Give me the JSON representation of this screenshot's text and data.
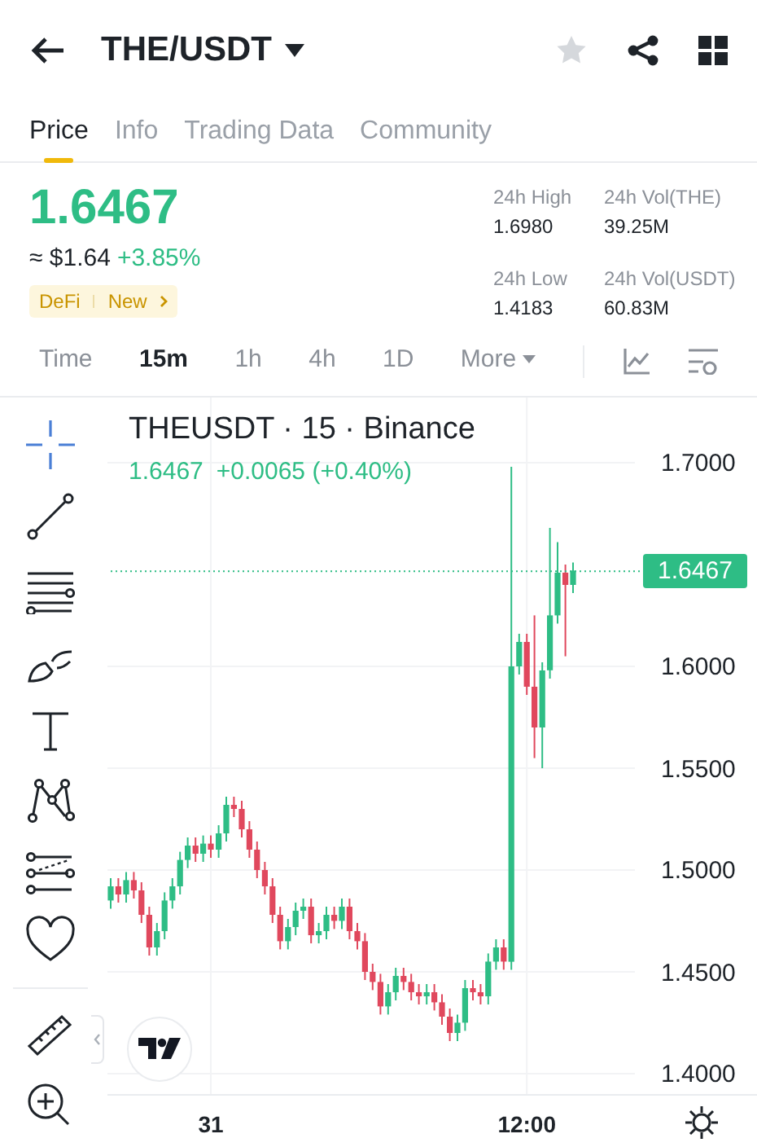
{
  "header": {
    "title": "THE/USDT",
    "favorite": false
  },
  "tabs": [
    {
      "label": "Price",
      "selected": true
    },
    {
      "label": "Info",
      "selected": false
    },
    {
      "label": "Trading Data",
      "selected": false
    },
    {
      "label": "Community",
      "selected": false
    }
  ],
  "price": {
    "last": "1.6467",
    "usd": "≈ $1.64",
    "change": "+3.85%",
    "tags": [
      "DeFi",
      "New"
    ]
  },
  "stats": [
    {
      "label": "24h High",
      "value": "1.6980"
    },
    {
      "label": "24h Vol(THE)",
      "value": "39.25M"
    },
    {
      "label": "24h Low",
      "value": "1.4183"
    },
    {
      "label": "24h Vol(USDT)",
      "value": "60.83M"
    }
  ],
  "intervals": [
    {
      "label": "Time",
      "selected": false,
      "kind": "plain"
    },
    {
      "label": "15m",
      "selected": true,
      "kind": "plain"
    },
    {
      "label": "1h",
      "selected": false,
      "kind": "plain"
    },
    {
      "label": "4h",
      "selected": false,
      "kind": "plain"
    },
    {
      "label": "1D",
      "selected": false,
      "kind": "plain"
    },
    {
      "label": "More",
      "selected": false,
      "kind": "menu"
    }
  ],
  "chart": {
    "legend": "THEUSDT · 15 · Binance",
    "last": "1.6467",
    "change": "+0.0065 (+0.40%)",
    "chart_data": {
      "type": "candlestick",
      "grid": true,
      "ref_lines": [
        {
          "axis": "y",
          "value": 1.6467,
          "label": "1.6467",
          "color": "#2ebd85"
        }
      ],
      "categories": [
        null,
        null,
        null,
        null,
        null,
        null,
        null,
        null,
        null,
        null,
        null,
        null,
        null,
        "31",
        null,
        null,
        null,
        null,
        null,
        null,
        null,
        null,
        null,
        null,
        null,
        null,
        null,
        null,
        null,
        null,
        null,
        null,
        null,
        null,
        null,
        null,
        null,
        null,
        null,
        null,
        null,
        null,
        null,
        null,
        null,
        null,
        null,
        null,
        null,
        null,
        null,
        null,
        null,
        null,
        "12:00",
        null,
        null,
        null,
        null,
        null,
        null
      ],
      "ohlc": [
        [
          1.485,
          1.496,
          1.481,
          1.492
        ],
        [
          1.492,
          1.496,
          1.484,
          1.488
        ],
        [
          1.488,
          1.499,
          1.484,
          1.495
        ],
        [
          1.495,
          1.499,
          1.486,
          1.49
        ],
        [
          1.49,
          1.494,
          1.474,
          1.478
        ],
        [
          1.478,
          1.482,
          1.458,
          1.462
        ],
        [
          1.462,
          1.474,
          1.458,
          1.47
        ],
        [
          1.47,
          1.489,
          1.466,
          1.485
        ],
        [
          1.485,
          1.496,
          1.481,
          1.492
        ],
        [
          1.492,
          1.509,
          1.488,
          1.505
        ],
        [
          1.505,
          1.516,
          1.501,
          1.512
        ],
        [
          1.512,
          1.516,
          1.504,
          1.508
        ],
        [
          1.508,
          1.517,
          1.504,
          1.513
        ],
        [
          1.513,
          1.517,
          1.506,
          1.51
        ],
        [
          1.51,
          1.522,
          1.506,
          1.518
        ],
        [
          1.518,
          1.536,
          1.514,
          1.532
        ],
        [
          1.532,
          1.536,
          1.526,
          1.53
        ],
        [
          1.53,
          1.534,
          1.516,
          1.52
        ],
        [
          1.52,
          1.524,
          1.506,
          1.51
        ],
        [
          1.51,
          1.514,
          1.496,
          1.5
        ],
        [
          1.5,
          1.504,
          1.488,
          1.492
        ],
        [
          1.492,
          1.496,
          1.474,
          1.478
        ],
        [
          1.478,
          1.482,
          1.461,
          1.465
        ],
        [
          1.465,
          1.476,
          1.461,
          1.472
        ],
        [
          1.472,
          1.484,
          1.468,
          1.48
        ],
        [
          1.48,
          1.486,
          1.476,
          1.482
        ],
        [
          1.482,
          1.486,
          1.464,
          1.468
        ],
        [
          1.468,
          1.474,
          1.464,
          1.47
        ],
        [
          1.47,
          1.482,
          1.466,
          1.478
        ],
        [
          1.478,
          1.482,
          1.471,
          1.475
        ],
        [
          1.475,
          1.486,
          1.471,
          1.482
        ],
        [
          1.482,
          1.486,
          1.466,
          1.47
        ],
        [
          1.47,
          1.474,
          1.461,
          1.465
        ],
        [
          1.465,
          1.469,
          1.446,
          1.45
        ],
        [
          1.45,
          1.454,
          1.441,
          1.445
        ],
        [
          1.445,
          1.449,
          1.429,
          1.433
        ],
        [
          1.433,
          1.444,
          1.429,
          1.44
        ],
        [
          1.44,
          1.452,
          1.436,
          1.448
        ],
        [
          1.448,
          1.452,
          1.441,
          1.445
        ],
        [
          1.445,
          1.449,
          1.436,
          1.44
        ],
        [
          1.44,
          1.444,
          1.434,
          1.438
        ],
        [
          1.438,
          1.444,
          1.434,
          1.44
        ],
        [
          1.44,
          1.444,
          1.431,
          1.435
        ],
        [
          1.435,
          1.439,
          1.424,
          1.428
        ],
        [
          1.428,
          1.432,
          1.416,
          1.42
        ],
        [
          1.42,
          1.429,
          1.416,
          1.425
        ],
        [
          1.425,
          1.446,
          1.421,
          1.442
        ],
        [
          1.442,
          1.446,
          1.436,
          1.44
        ],
        [
          1.44,
          1.444,
          1.434,
          1.438
        ],
        [
          1.438,
          1.459,
          1.434,
          1.455
        ],
        [
          1.455,
          1.466,
          1.451,
          1.462
        ],
        [
          1.462,
          1.466,
          1.451,
          1.455
        ],
        [
          1.455,
          1.698,
          1.451,
          1.6
        ],
        [
          1.6,
          1.616,
          1.596,
          1.612
        ],
        [
          1.612,
          1.616,
          1.586,
          1.59
        ],
        [
          1.59,
          1.625,
          1.555,
          1.57
        ],
        [
          1.57,
          1.602,
          1.55,
          1.598
        ],
        [
          1.598,
          1.668,
          1.594,
          1.625
        ],
        [
          1.625,
          1.661,
          1.621,
          1.646
        ],
        [
          1.646,
          1.65,
          1.605,
          1.64
        ],
        [
          1.64,
          1.651,
          1.636,
          1.647
        ]
      ],
      "ylim": [
        1.3896,
        1.732
      ],
      "yticks": [
        {
          "value": 1.7,
          "label": "1.7000"
        },
        {
          "value": 1.6,
          "label": "1.6000"
        },
        {
          "value": 1.55,
          "label": "1.5500"
        },
        {
          "value": 1.5,
          "label": "1.5000"
        },
        {
          "value": 1.45,
          "label": "1.4500"
        },
        {
          "value": 1.4,
          "label": "1.4000"
        }
      ]
    }
  }
}
